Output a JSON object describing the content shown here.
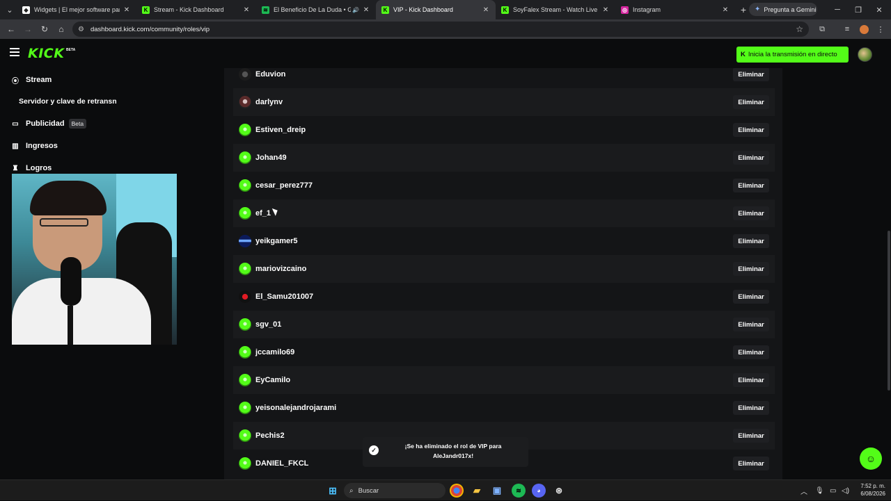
{
  "browser": {
    "tabs": [
      {
        "label": "Widgets | El mejor software para",
        "icon": "widget-icon",
        "active": false
      },
      {
        "label": "Stream - Kick Dashboard",
        "icon": "kick-icon",
        "active": false
      },
      {
        "label": "El Beneficio De La Duda • G",
        "icon": "spotify-icon",
        "active": false,
        "sound": true
      },
      {
        "label": "VIP - Kick Dashboard",
        "icon": "kick-icon",
        "active": true
      },
      {
        "label": "SoyFalex Stream - Watch Live o",
        "icon": "kick-icon",
        "active": false
      },
      {
        "label": "Instagram",
        "icon": "instagram-icon",
        "active": false
      }
    ],
    "gemini_label": "Pregunta a Gemini",
    "url": "dashboard.kick.com/community/roles/vip"
  },
  "header": {
    "logo": "KICK",
    "logo_badge": "BETA",
    "go_live_label": "Inicia la transmisión en directo"
  },
  "sidebar": {
    "items": [
      {
        "label": "Stream",
        "icon": "broadcast-icon"
      },
      {
        "label": "Servidor y clave de retransn",
        "icon": ""
      },
      {
        "label": "Publicidad",
        "icon": "ad-icon",
        "badge": "Beta"
      },
      {
        "label": "Ingresos",
        "icon": "chart-icon"
      },
      {
        "label": "Logros",
        "icon": "trophy-icon"
      }
    ]
  },
  "vip_list": {
    "remove_label": "Eliminar",
    "users": [
      {
        "name": "Eduvion",
        "avatar": "dark"
      },
      {
        "name": "darlynv",
        "avatar": "maroon"
      },
      {
        "name": "Estiven_dreip",
        "avatar": "green"
      },
      {
        "name": "Johan49",
        "avatar": "green"
      },
      {
        "name": "cesar_perez777",
        "avatar": "green"
      },
      {
        "name": "ef_1",
        "avatar": "green"
      },
      {
        "name": "yeikgamer5",
        "avatar": "blue"
      },
      {
        "name": "mariovizcaino",
        "avatar": "green"
      },
      {
        "name": "El_Samu201007",
        "avatar": "red"
      },
      {
        "name": "sgv_01",
        "avatar": "green"
      },
      {
        "name": "jccamilo69",
        "avatar": "green"
      },
      {
        "name": "EyCamilo",
        "avatar": "green"
      },
      {
        "name": "yeisonalejandrojarami",
        "avatar": "green"
      },
      {
        "name": "Pechis2",
        "avatar": "green"
      },
      {
        "name": "DANIEL_FKCL",
        "avatar": "green"
      }
    ]
  },
  "toast": {
    "line1": "¡Se ha eliminado el rol de VIP para",
    "line2": "AleJandr017x!"
  },
  "taskbar": {
    "search_label": "Buscar",
    "time": "7:52 p. m.",
    "date": "6/08/2026"
  },
  "colors": {
    "brand": "#53fc18",
    "background": "#0b0c0d",
    "panel": "#141517"
  }
}
